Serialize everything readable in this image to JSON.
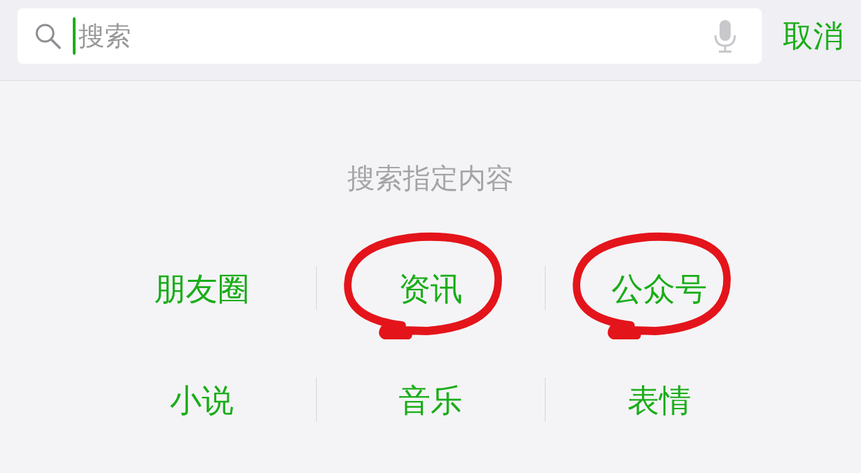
{
  "search": {
    "placeholder": "搜索",
    "cancel": "取消"
  },
  "section_title": "搜索指定内容",
  "options": [
    {
      "label": "朋友圈",
      "circled": false
    },
    {
      "label": "资讯",
      "circled": true
    },
    {
      "label": "公众号",
      "circled": true
    },
    {
      "label": "小说",
      "circled": false
    },
    {
      "label": "音乐",
      "circled": false
    },
    {
      "label": "表情",
      "circled": false
    }
  ]
}
